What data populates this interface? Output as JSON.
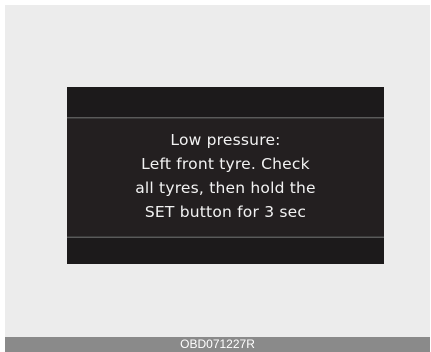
{
  "display": {
    "lines": [
      "Low pressure:",
      "Left front tyre. Check",
      "all tyres, then hold the",
      "SET button for 3 sec"
    ]
  },
  "caption": "OBD071227R",
  "colors": {
    "screen_background": "#231f20",
    "text": "#f2f2f2",
    "frame_background": "#ececec",
    "caption_bar": "#8a8a8a"
  }
}
